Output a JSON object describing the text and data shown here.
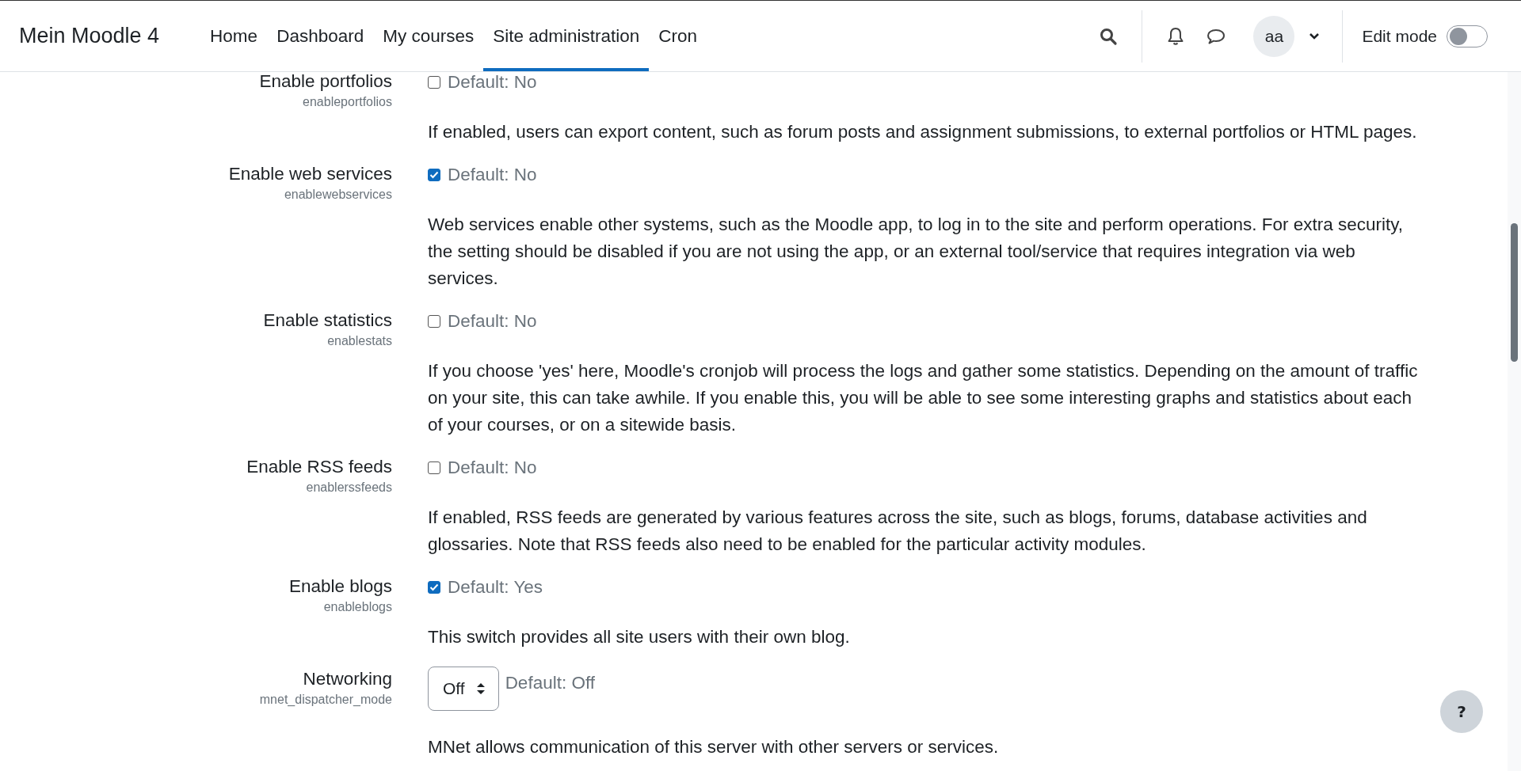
{
  "site_name": "Mein Moodle 4",
  "nav": [
    {
      "label": "Home",
      "selected": false
    },
    {
      "label": "Dashboard",
      "selected": false
    },
    {
      "label": "My courses",
      "selected": false
    },
    {
      "label": "Site administration",
      "selected": true
    },
    {
      "label": "Cron",
      "selected": false
    }
  ],
  "user": {
    "initials": "aa"
  },
  "edit_mode": {
    "label": "Edit mode",
    "on": false
  },
  "settings": [
    {
      "kind": "checkbox",
      "label": "Enable portfolios",
      "name": "enableportfolios",
      "checked": false,
      "default": "Default: No",
      "description": "If enabled, users can export content, such as forum posts and assignment submissions, to external portfolios or HTML pages."
    },
    {
      "kind": "checkbox",
      "label": "Enable web services",
      "name": "enablewebservices",
      "checked": true,
      "default": "Default: No",
      "description": "Web services enable other systems, such as the Moodle app, to log in to the site and perform operations. For extra security, the setting should be disabled if you are not using the app, or an external tool/service that requires integration via web services."
    },
    {
      "kind": "checkbox",
      "label": "Enable statistics",
      "name": "enablestats",
      "checked": false,
      "default": "Default: No",
      "description": "If you choose 'yes' here, Moodle's cronjob will process the logs and gather some statistics. Depending on the amount of traffic on your site, this can take awhile. If you enable this, you will be able to see some interesting graphs and statistics about each of your courses, or on a sitewide basis."
    },
    {
      "kind": "checkbox",
      "label": "Enable RSS feeds",
      "name": "enablerssfeeds",
      "checked": false,
      "default": "Default: No",
      "description": "If enabled, RSS feeds are generated by various features across the site, such as blogs, forums, database activities and glossaries. Note that RSS feeds also need to be enabled for the particular activity modules."
    },
    {
      "kind": "checkbox",
      "label": "Enable blogs",
      "name": "enableblogs",
      "checked": true,
      "default": "Default: Yes",
      "description": "This switch provides all site users with their own blog."
    },
    {
      "kind": "select",
      "label": "Networking",
      "name": "mnet_dispatcher_mode",
      "value": "Off",
      "default": "Default: Off",
      "description": "MNet allows communication of this server with other servers or services."
    }
  ],
  "help": "?"
}
